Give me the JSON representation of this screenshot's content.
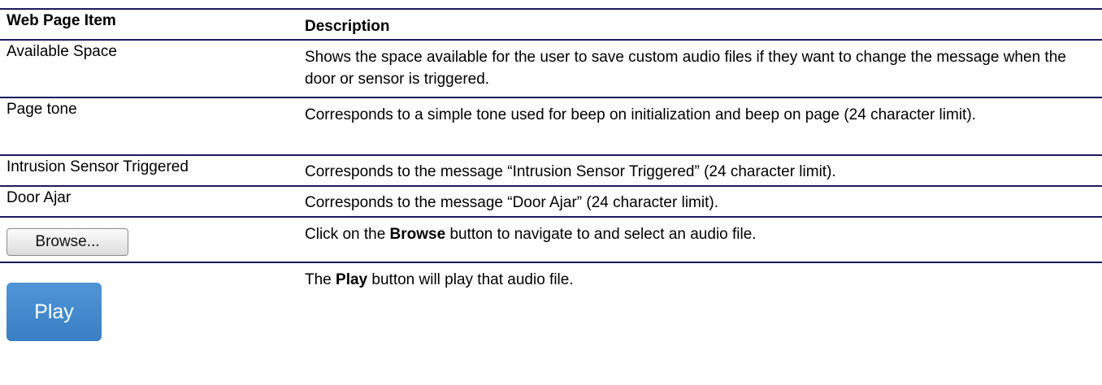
{
  "header": {
    "item": "Web Page Item",
    "description": "Description"
  },
  "rows": [
    {
      "item": "Available Space",
      "description": "Shows the space available for the user to save custom audio files if they want to change the message when the door or sensor is triggered."
    },
    {
      "item": "Page tone",
      "description": "Corresponds to a simple tone used for beep on initialization and beep on page (24 character limit)."
    },
    {
      "item": "Intrusion Sensor Triggered",
      "description": "Corresponds to the message “Intrusion Sensor Triggered” (24 character limit)."
    },
    {
      "item": "Door Ajar",
      "description": "Corresponds to the message “Door Ajar” (24 character limit)."
    }
  ],
  "browse_row": {
    "button_label": "Browse...",
    "desc_before": "Click on the ",
    "desc_bold": "Browse",
    "desc_after": " button to navigate to and select an audio file."
  },
  "play_row": {
    "button_label": "Play",
    "desc_before": "The ",
    "desc_bold": "Play",
    "desc_after": " button will play that audio file."
  },
  "colors": {
    "rule": "#1a1a5e",
    "play_button": "#4a8fd2"
  }
}
